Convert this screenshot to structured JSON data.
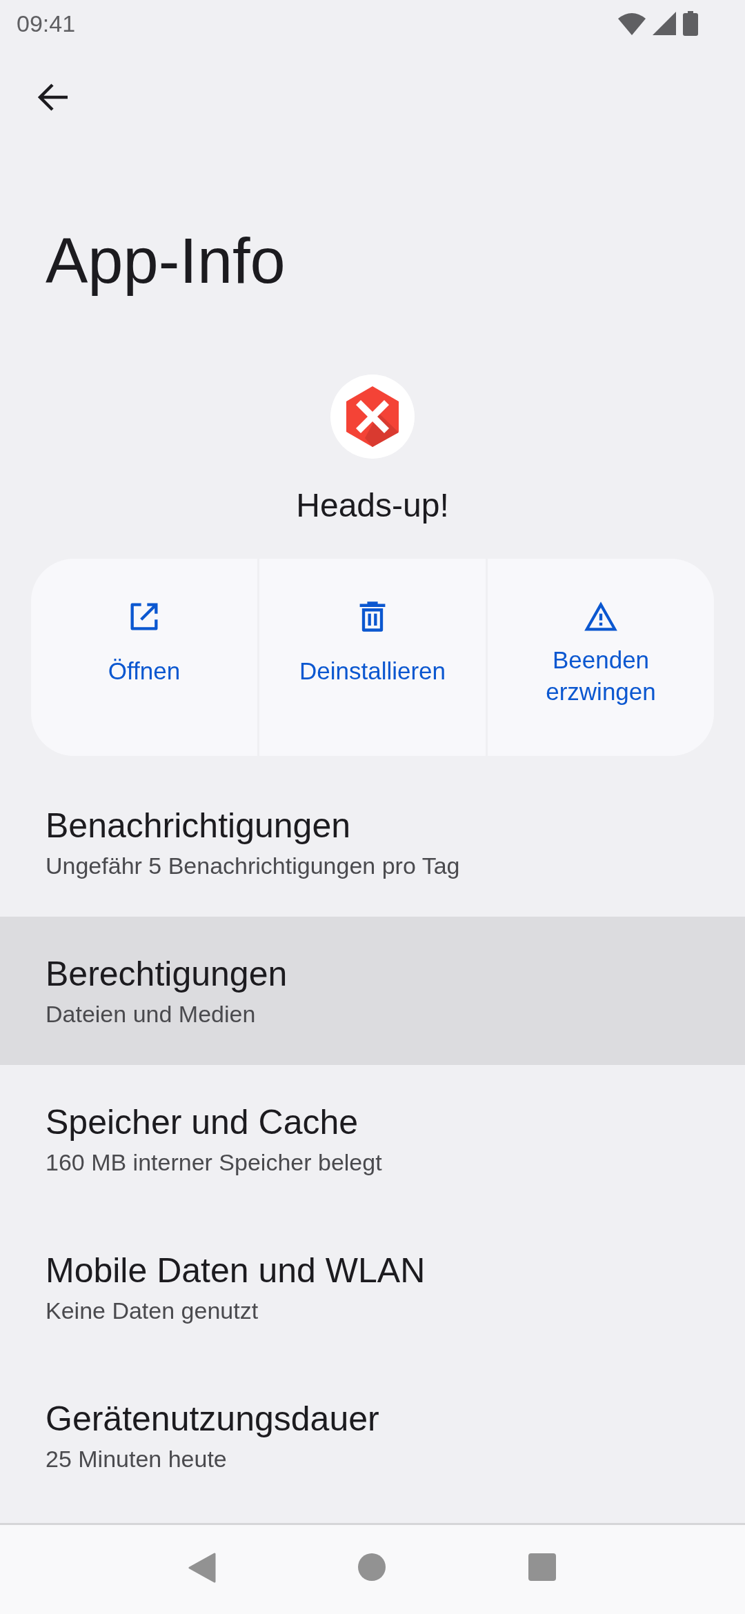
{
  "status_bar": {
    "time": "09:41"
  },
  "title": "App-Info",
  "app": {
    "name": "Heads-up!"
  },
  "actions": [
    {
      "kind": "open",
      "label": "Öffnen"
    },
    {
      "kind": "uninstall",
      "label": "Deinstallieren"
    },
    {
      "kind": "force_stop",
      "label": "Beenden erzwingen"
    }
  ],
  "settings": [
    {
      "title": "Benachrichtigungen",
      "subtitle": "Ungefähr 5 Benachrichtigungen pro Tag",
      "highlighted": false
    },
    {
      "title": "Berechtigungen",
      "subtitle": "Dateien und Medien",
      "highlighted": true
    },
    {
      "title": "Speicher und Cache",
      "subtitle": "160 MB interner Speicher belegt",
      "highlighted": false
    },
    {
      "title": "Mobile Daten und WLAN",
      "subtitle": "Keine Daten genutzt",
      "highlighted": false
    },
    {
      "title": "Gerätenutzungsdauer",
      "subtitle": "25 Minuten heute",
      "highlighted": false
    }
  ]
}
